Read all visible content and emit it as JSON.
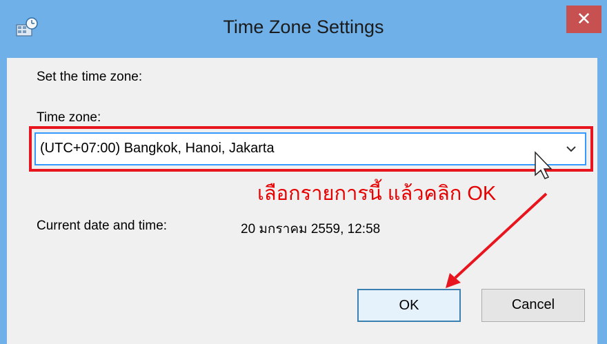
{
  "window": {
    "title": "Time Zone Settings",
    "close_glyph": "✕"
  },
  "dialog": {
    "set_label": "Set the time zone:",
    "time_zone_label": "Time zone:",
    "time_zone_value": "(UTC+07:00) Bangkok, Hanoi, Jakarta",
    "current_label": "Current date and time:",
    "current_value": "20 มกราคม 2559, 12:58",
    "ok_label": "OK",
    "cancel_label": "Cancel"
  },
  "annotation": {
    "text": "เลือกรายการนี้ แล้วคลิก OK",
    "color": "#e60000"
  },
  "colors": {
    "title_bar": "#6fb0e8",
    "close_button": "#c75050",
    "highlight_border": "#e8141e",
    "dialog_bg": "#f0f0f0"
  },
  "icons": {
    "app": "timezone-app-icon",
    "close": "close-icon",
    "dropdown": "chevron-down-icon",
    "cursor": "mouse-pointer-icon",
    "arrow": "red-arrow"
  }
}
